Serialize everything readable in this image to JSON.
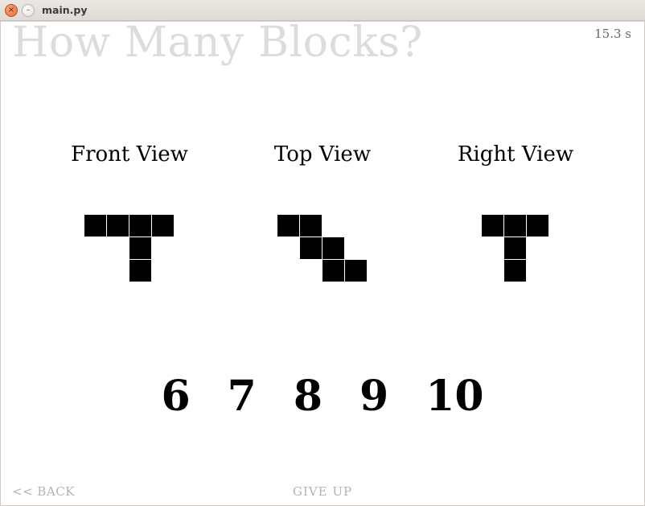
{
  "window": {
    "title": "main.py"
  },
  "question": {
    "title": "How Many Blocks?"
  },
  "timer": {
    "display": "15.3 s"
  },
  "views": [
    {
      "label": "Front View",
      "cell_size": 28,
      "cols": 4,
      "rows": 3,
      "cells": [
        [
          0,
          0
        ],
        [
          0,
          1
        ],
        [
          0,
          2
        ],
        [
          0,
          3
        ],
        [
          1,
          2
        ],
        [
          2,
          2
        ]
      ]
    },
    {
      "label": "Top View",
      "cell_size": 28,
      "cols": 4,
      "rows": 3,
      "cells": [
        [
          0,
          0
        ],
        [
          0,
          1
        ],
        [
          1,
          1
        ],
        [
          1,
          2
        ],
        [
          2,
          2
        ],
        [
          2,
          3
        ]
      ]
    },
    {
      "label": "Right View",
      "cell_size": 28,
      "cols": 3,
      "rows": 3,
      "cells": [
        [
          0,
          0
        ],
        [
          0,
          1
        ],
        [
          0,
          2
        ],
        [
          1,
          1
        ],
        [
          2,
          1
        ]
      ]
    }
  ],
  "answers": [
    "6",
    "7",
    "8",
    "9",
    "10"
  ],
  "footer": {
    "back": "<< BACK",
    "giveup": "GIVE UP"
  }
}
